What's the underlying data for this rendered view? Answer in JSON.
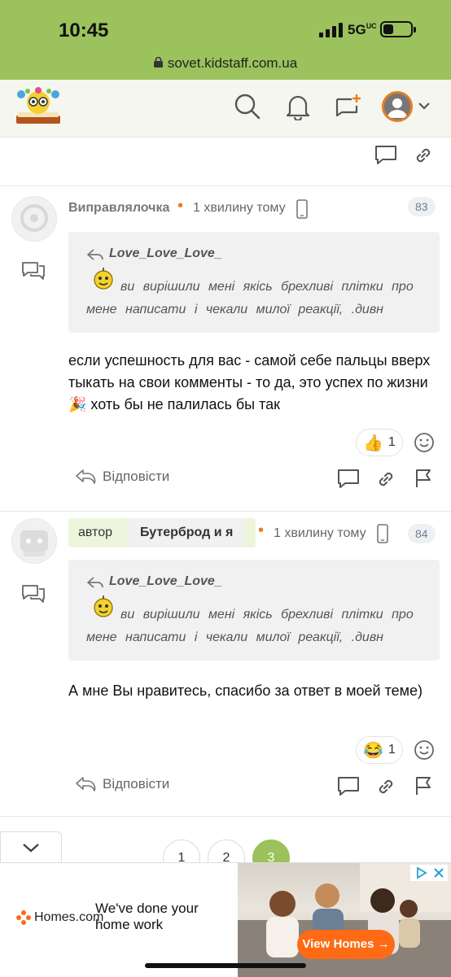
{
  "status_bar": {
    "time": "10:45",
    "network": "5G",
    "network_sup": "UC"
  },
  "browser": {
    "url": "sovet.kidstaff.com.ua"
  },
  "header": {
    "icons": [
      "search-icon",
      "bell-icon",
      "new-message-icon",
      "avatar",
      "chevron-down-icon"
    ]
  },
  "posts": [
    {
      "author": "Виправлялочка",
      "time_ago": "1 хвилину тому",
      "number": "83",
      "quote_author": "Love_Love_Love_",
      "quote_text": "ви вирішили мені якісь брехливі плітки про мене написати і чекали милої реакції, .дивн",
      "body": "если успешность для вас - самой себе пальцы вверх тыкать на свои комменты - то да, это успех по жизни 🎉 хоть бы не палилась бы так",
      "reaction_emoji": "👍",
      "reaction_count": "1",
      "reply_label": "Відповісти"
    },
    {
      "role": "автор",
      "author": "Бутерброд и я",
      "time_ago": "1 хвилину тому",
      "number": "84",
      "quote_author": "Love_Love_Love_",
      "quote_text": "ви вирішили мені якісь брехливі плітки про мене написати і чекали милої реакції, .дивн",
      "body": "А мне Вы нравитесь, спасибо за ответ в моей теме)",
      "reaction_emoji": "😂",
      "reaction_count": "1",
      "reply_label": "Відповісти"
    }
  ],
  "pagination": {
    "pages": [
      "1",
      "2",
      "3"
    ],
    "current": "3"
  },
  "ad": {
    "brand": "Homes.com",
    "headline_line1": "We've done your",
    "headline_line2": "home work",
    "cta": "View Homes →"
  },
  "colors": {
    "brand_green": "#9bc25c",
    "accent_orange": "#e67e22",
    "cta_orange": "#ff6a14"
  }
}
